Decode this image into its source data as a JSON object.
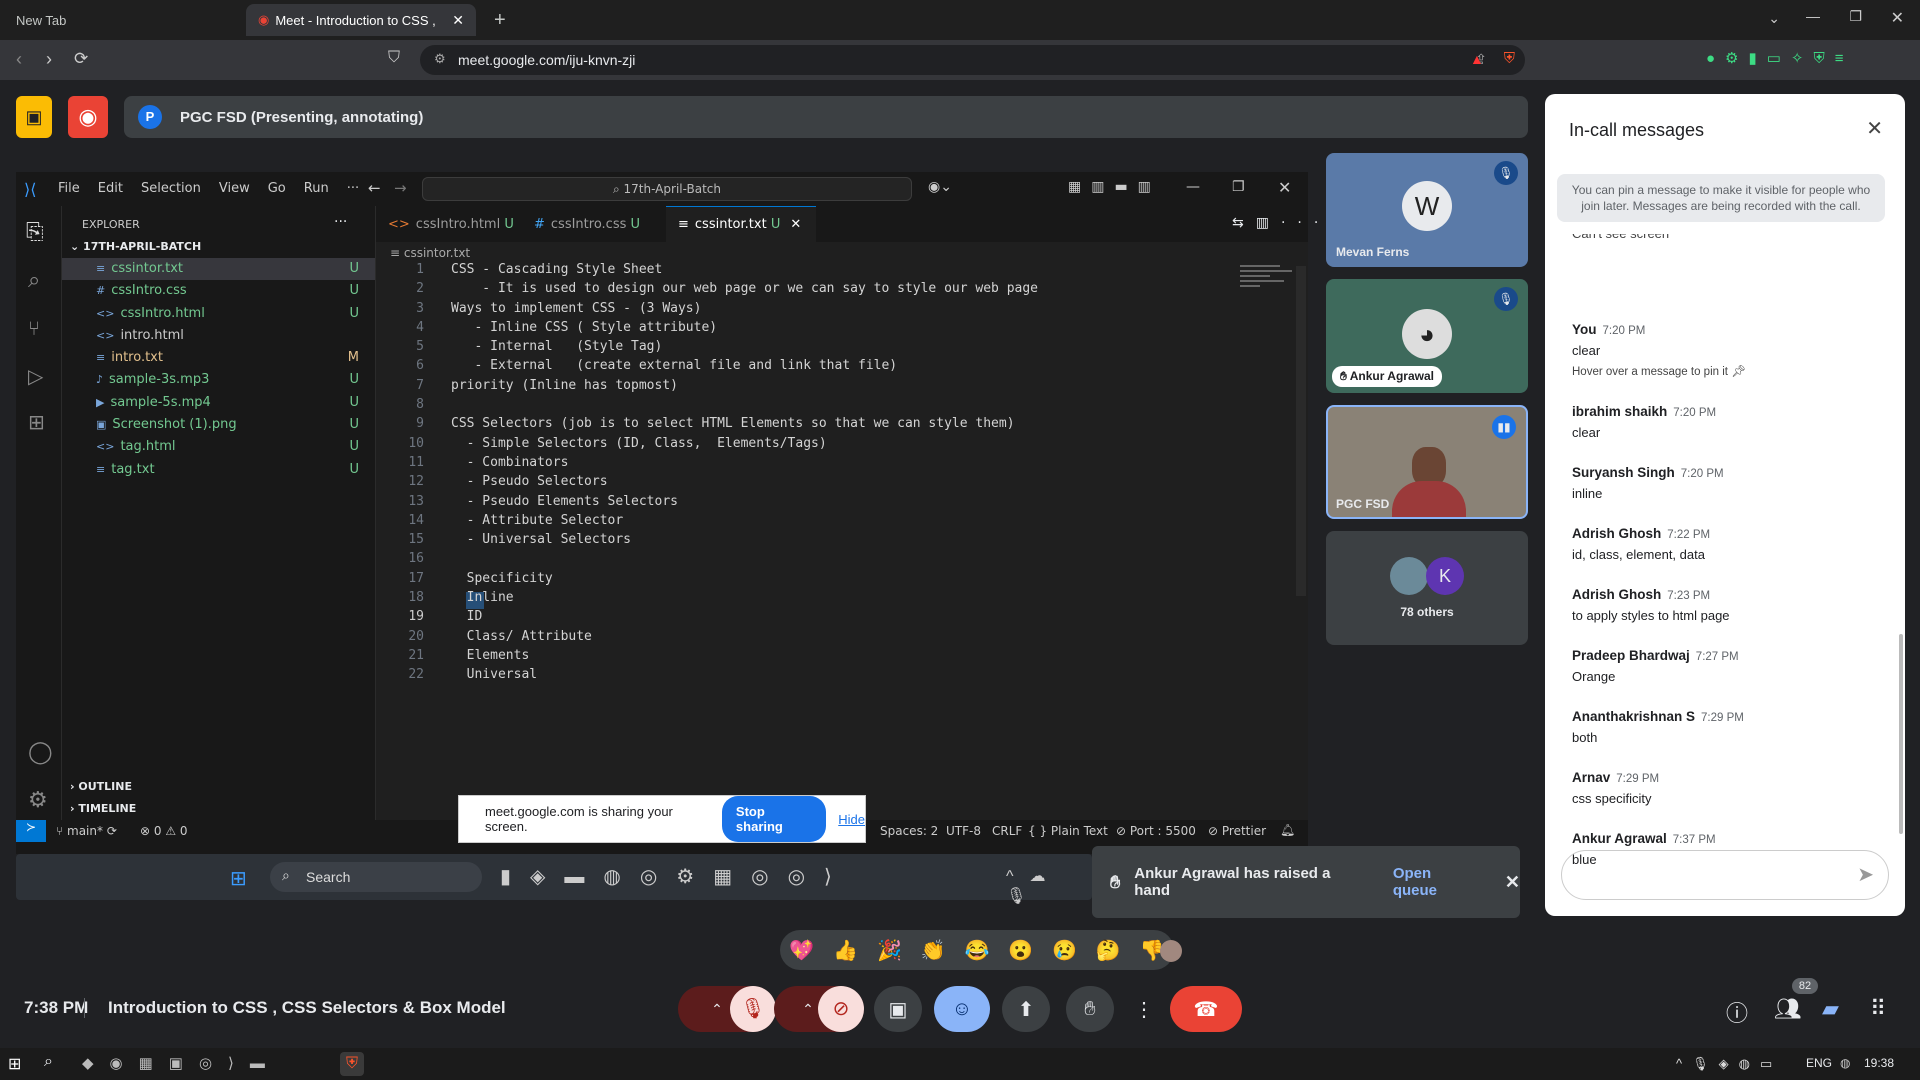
{
  "browser": {
    "tabs": [
      {
        "label": "New Tab"
      },
      {
        "label": "Meet - Introduction to CSS ,"
      }
    ],
    "url": "meet.google.com/iju-knvn-zji"
  },
  "meet": {
    "presenting_label": "PGC FSD (Presenting, annotating)",
    "avatar_letter": "P",
    "time": "7:38 PM",
    "meeting_title": "Introduction to CSS , CSS Selectors & Box Model",
    "participants_badge": "82"
  },
  "vscode": {
    "menu": [
      "File",
      "Edit",
      "Selection",
      "View",
      "Go",
      "Run",
      "···"
    ],
    "search": "17th-April-Batch",
    "explorer_title": "EXPLORER",
    "folder": "17TH-APRIL-BATCH",
    "files": [
      {
        "name": "cssintor.txt",
        "icon": "≡",
        "badge": "U",
        "color": "#73c991"
      },
      {
        "name": "cssIntro.css",
        "icon": "#",
        "badge": "U",
        "color": "#73c991"
      },
      {
        "name": "cssIntro.html",
        "icon": "<>",
        "badge": "U",
        "color": "#73c991"
      },
      {
        "name": "intro.html",
        "icon": "<>",
        "badge": "",
        "color": "#cccccc"
      },
      {
        "name": "intro.txt",
        "icon": "≡",
        "badge": "M",
        "color": "#e2c08d"
      },
      {
        "name": "sample-3s.mp3",
        "icon": "♪",
        "badge": "U",
        "color": "#73c991"
      },
      {
        "name": "sample-5s.mp4",
        "icon": "▶",
        "badge": "U",
        "color": "#73c991"
      },
      {
        "name": "Screenshot (1).png",
        "icon": "▣",
        "badge": "U",
        "color": "#73c991"
      },
      {
        "name": "tag.html",
        "icon": "<>",
        "badge": "U",
        "color": "#73c991"
      },
      {
        "name": "tag.txt",
        "icon": "≡",
        "badge": "U",
        "color": "#73c991"
      }
    ],
    "outline": "OUTLINE",
    "timeline": "TIMELINE",
    "tabs": [
      {
        "label": "cssIntro.html",
        "mark": "U"
      },
      {
        "label": "cssIntro.css",
        "mark": "U"
      },
      {
        "label": "cssintor.txt",
        "mark": "U"
      }
    ],
    "breadcrumb": "cssintor.txt",
    "code": [
      "CSS - Cascading Style Sheet",
      "    - It is used to design our web page or we can say to style our web page",
      "Ways to implement CSS - (3 Ways)",
      "   - Inline CSS ( Style attribute)",
      "   - Internal   (Style Tag)",
      "   - External   (create external file and link that file)",
      "priority (Inline has topmost)",
      "",
      "CSS Selectors (job is to select HTML Elements so that we can style them)",
      "  - Simple Selectors (ID, Class,  Elements/Tags)",
      "  - Combinators",
      "  - Pseudo Selectors",
      "  - Pseudo Elements Selectors",
      "  - Attribute Selector",
      "  - Universal Selectors",
      "",
      "  Specificity",
      "  Inline",
      "  ID",
      "  Class/ Attribute",
      "  Elements",
      "  Universal"
    ],
    "status": {
      "branch": "main*",
      "problems": "⊗ 0 ⚠ 0",
      "spaces": "Spaces: 2",
      "encoding": "UTF-8",
      "eol": "CRLF",
      "lang": "{ } Plain Text",
      "port": "Port : 5500",
      "prettier": "Prettier"
    }
  },
  "sharing": {
    "text": "meet.google.com is sharing your screen.",
    "stop": "Stop sharing",
    "hide": "Hide"
  },
  "inner_taskbar": {
    "search": "Search"
  },
  "toast": {
    "text": "Ankur Agrawal has raised a hand",
    "action": "Open queue"
  },
  "tiles": [
    {
      "name": "Mevan Ferns"
    },
    {
      "name": "Ankur Agrawal"
    },
    {
      "name": "PGC FSD"
    },
    {
      "others": "78 others",
      "letter": "K"
    }
  ],
  "panel": {
    "title": "In-call messages",
    "info": "You can pin a message to make it visible for people who join later. Messages are being recorded with the call.",
    "cut": "Can't see screen",
    "messages": [
      {
        "who": "You",
        "time": "7:20 PM",
        "text": "clear",
        "hint": "Hover over a message to pin it"
      },
      {
        "who": "ibrahim shaikh",
        "time": "7:20 PM",
        "text": "clear"
      },
      {
        "who": "Suryansh Singh",
        "time": "7:20 PM",
        "text": "inline"
      },
      {
        "who": "Adrish Ghosh",
        "time": "7:22 PM",
        "text": "id, class, element, data"
      },
      {
        "who": "Adrish Ghosh",
        "time": "7:23 PM",
        "text": "to apply styles to html page"
      },
      {
        "who": "Pradeep Bhardwaj",
        "time": "7:27 PM",
        "text": "Orange"
      },
      {
        "who": "Ananthakrishnan S",
        "time": "7:29 PM",
        "text": "both"
      },
      {
        "who": "Arnav",
        "time": "7:29 PM",
        "text": "css specificity"
      },
      {
        "who": "Ankur Agrawal",
        "time": "7:37 PM",
        "text": "blue"
      }
    ]
  },
  "reactions": [
    "💖",
    "👍",
    "🎉",
    "👏",
    "😂",
    "😮",
    "😢",
    "🤔",
    "👎"
  ],
  "os": {
    "lang": "ENG",
    "clock": "19:38"
  }
}
